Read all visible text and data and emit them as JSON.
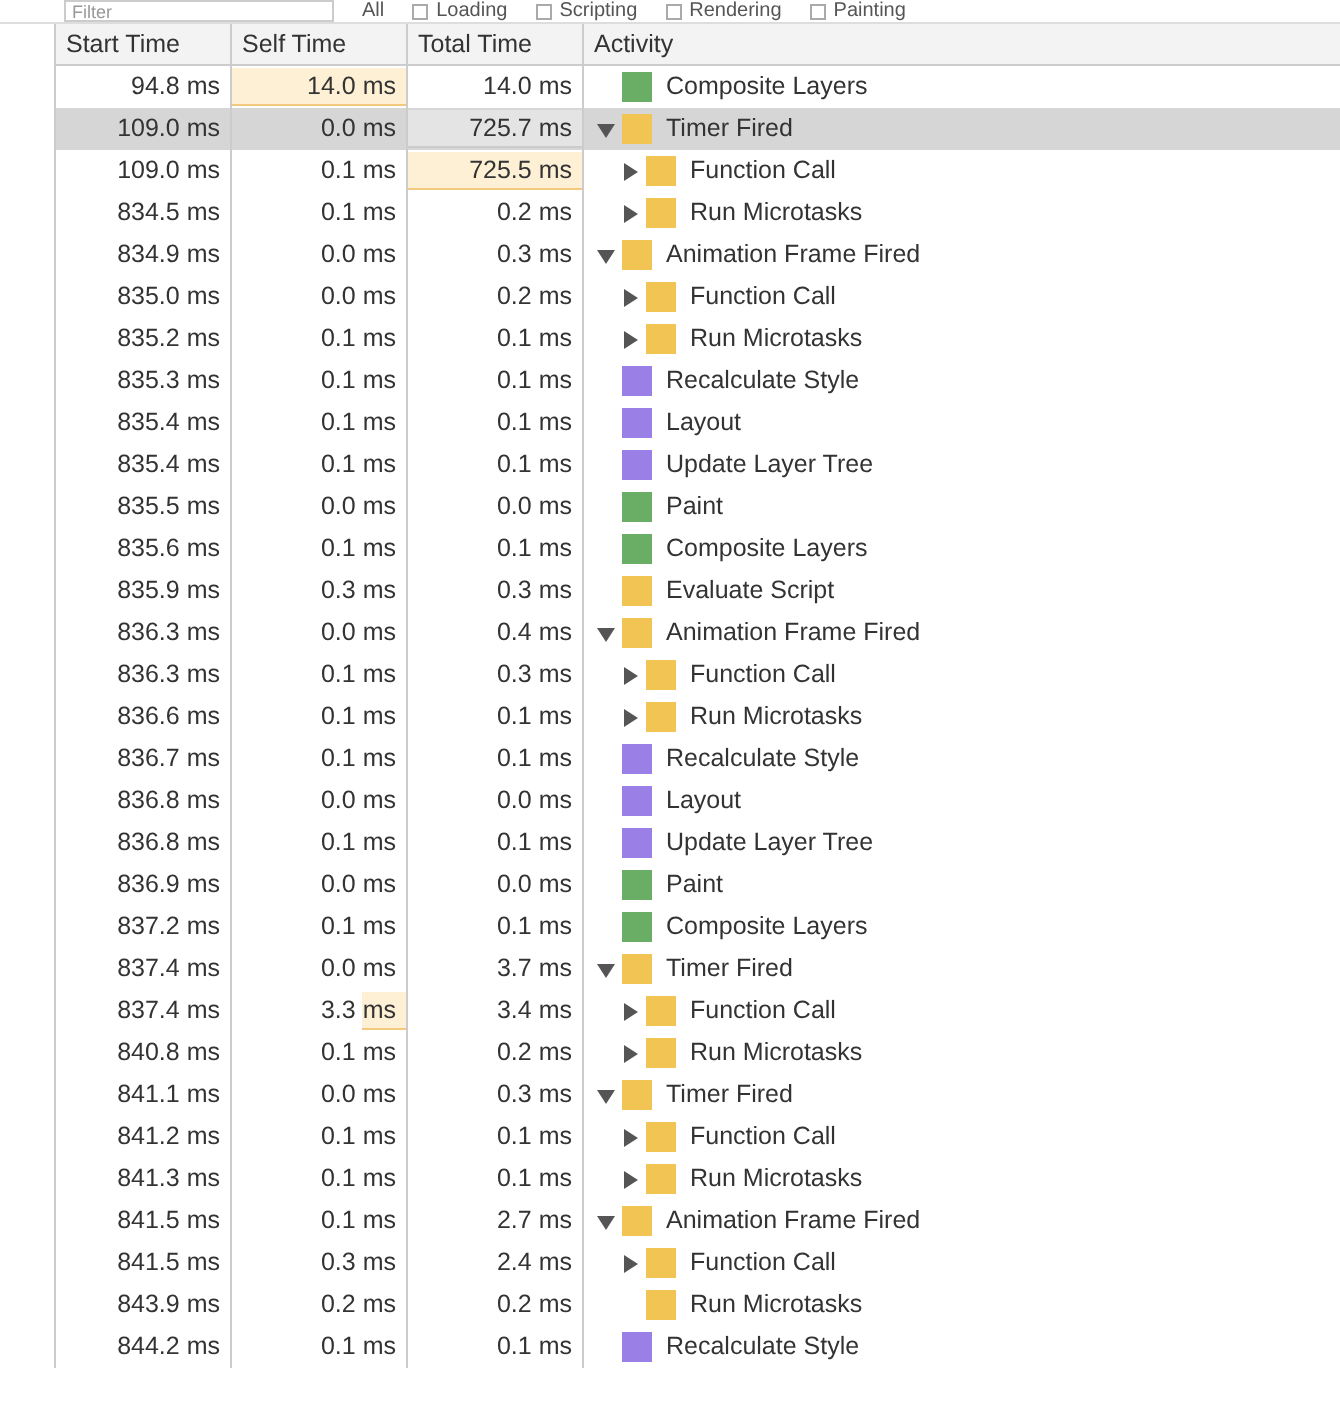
{
  "toolbar": {
    "filter": {
      "placeholder": "Filter"
    },
    "scope": "All",
    "categories": [
      {
        "label": "Loading",
        "checked": false
      },
      {
        "label": "Scripting",
        "checked": false
      },
      {
        "label": "Rendering",
        "checked": false
      },
      {
        "label": "Painting",
        "checked": false
      }
    ]
  },
  "table": {
    "columns": [
      "Start Time",
      "Self Time",
      "Total Time",
      "Activity"
    ],
    "rows": [
      {
        "start": "94.8 ms",
        "self": {
          "text": "14.0 ms",
          "level": 1
        },
        "total": {
          "text": "14.0 ms"
        },
        "activity": "Composite Layers",
        "color": "#6aad64",
        "selected": false
      },
      {
        "start": "109.0 ms",
        "self": {
          "text": "0.0 ms"
        },
        "total": {
          "text": "725.7 ms",
          "level": 1
        },
        "activity": "Timer Fired",
        "color": "#f1c453",
        "selected": true,
        "expanded": true,
        "children": [
          {
            "start": "109.0 ms",
            "self": {
              "text": "0.1 ms"
            },
            "total": {
              "text": "725.5 ms",
              "level": 1
            },
            "activity": "Function Call",
            "color": "#f1c453",
            "selected": false,
            "expanded": false
          },
          {
            "start": "834.5 ms",
            "self": {
              "text": "0.1 ms"
            },
            "total": {
              "text": "0.2 ms"
            },
            "activity": "Run Microtasks",
            "color": "#f1c453",
            "selected": false,
            "expanded": false
          }
        ]
      },
      {
        "start": "834.9 ms",
        "self": {
          "text": "0.0 ms"
        },
        "total": {
          "text": "0.3 ms"
        },
        "activity": "Animation Frame Fired",
        "color": "#f1c453",
        "selected": false,
        "expanded": true,
        "children": [
          {
            "start": "835.0 ms",
            "self": {
              "text": "0.0 ms"
            },
            "total": {
              "text": "0.2 ms"
            },
            "activity": "Function Call",
            "color": "#f1c453",
            "selected": false,
            "expanded": false
          },
          {
            "start": "835.2 ms",
            "self": {
              "text": "0.1 ms"
            },
            "total": {
              "text": "0.1 ms"
            },
            "activity": "Run Microtasks",
            "color": "#f1c453",
            "selected": false,
            "expanded": false
          }
        ]
      },
      {
        "start": "835.3 ms",
        "self": {
          "text": "0.1 ms"
        },
        "total": {
          "text": "0.1 ms"
        },
        "activity": "Recalculate Style",
        "color": "#9a7fe6",
        "selected": false
      },
      {
        "start": "835.4 ms",
        "self": {
          "text": "0.1 ms"
        },
        "total": {
          "text": "0.1 ms"
        },
        "activity": "Layout",
        "color": "#9a7fe6",
        "selected": false
      },
      {
        "start": "835.4 ms",
        "self": {
          "text": "0.1 ms"
        },
        "total": {
          "text": "0.1 ms"
        },
        "activity": "Update Layer Tree",
        "color": "#9a7fe6",
        "selected": false
      },
      {
        "start": "835.5 ms",
        "self": {
          "text": "0.0 ms"
        },
        "total": {
          "text": "0.0 ms"
        },
        "activity": "Paint",
        "color": "#6aad64",
        "selected": false
      },
      {
        "start": "835.6 ms",
        "self": {
          "text": "0.1 ms"
        },
        "total": {
          "text": "0.1 ms"
        },
        "activity": "Composite Layers",
        "color": "#6aad64",
        "selected": false
      },
      {
        "start": "835.9 ms",
        "self": {
          "text": "0.3 ms"
        },
        "total": {
          "text": "0.3 ms"
        },
        "activity": "Evaluate Script",
        "color": "#f1c453",
        "selected": false
      },
      {
        "start": "836.3 ms",
        "self": {
          "text": "0.0 ms"
        },
        "total": {
          "text": "0.4 ms"
        },
        "activity": "Animation Frame Fired",
        "color": "#f1c453",
        "selected": false,
        "expanded": true,
        "children": [
          {
            "start": "836.3 ms",
            "self": {
              "text": "0.1 ms"
            },
            "total": {
              "text": "0.3 ms"
            },
            "activity": "Function Call",
            "color": "#f1c453",
            "selected": false,
            "expanded": false
          },
          {
            "start": "836.6 ms",
            "self": {
              "text": "0.1 ms"
            },
            "total": {
              "text": "0.1 ms"
            },
            "activity": "Run Microtasks",
            "color": "#f1c453",
            "selected": false,
            "expanded": false
          }
        ]
      },
      {
        "start": "836.7 ms",
        "self": {
          "text": "0.1 ms"
        },
        "total": {
          "text": "0.1 ms"
        },
        "activity": "Recalculate Style",
        "color": "#9a7fe6",
        "selected": false
      },
      {
        "start": "836.8 ms",
        "self": {
          "text": "0.0 ms"
        },
        "total": {
          "text": "0.0 ms"
        },
        "activity": "Layout",
        "color": "#9a7fe6",
        "selected": false
      },
      {
        "start": "836.8 ms",
        "self": {
          "text": "0.1 ms"
        },
        "total": {
          "text": "0.1 ms"
        },
        "activity": "Update Layer Tree",
        "color": "#9a7fe6",
        "selected": false
      },
      {
        "start": "836.9 ms",
        "self": {
          "text": "0.0 ms"
        },
        "total": {
          "text": "0.0 ms"
        },
        "activity": "Paint",
        "color": "#6aad64",
        "selected": false
      },
      {
        "start": "837.2 ms",
        "self": {
          "text": "0.1 ms"
        },
        "total": {
          "text": "0.1 ms"
        },
        "activity": "Composite Layers",
        "color": "#6aad64",
        "selected": false
      },
      {
        "start": "837.4 ms",
        "self": {
          "text": "0.0 ms"
        },
        "total": {
          "text": "3.7 ms"
        },
        "activity": "Timer Fired",
        "color": "#f1c453",
        "selected": false,
        "expanded": true,
        "children": [
          {
            "start": "837.4 ms",
            "self": {
              "text": "3.3 ms",
              "level": 0.25
            },
            "total": {
              "text": "3.4 ms"
            },
            "activity": "Function Call",
            "color": "#f1c453",
            "selected": false,
            "expanded": false
          },
          {
            "start": "840.8 ms",
            "self": {
              "text": "0.1 ms"
            },
            "total": {
              "text": "0.2 ms"
            },
            "activity": "Run Microtasks",
            "color": "#f1c453",
            "selected": false,
            "expanded": false
          }
        ]
      },
      {
        "start": "841.1 ms",
        "self": {
          "text": "0.0 ms"
        },
        "total": {
          "text": "0.3 ms"
        },
        "activity": "Timer Fired",
        "color": "#f1c453",
        "selected": false,
        "expanded": true,
        "children": [
          {
            "start": "841.2 ms",
            "self": {
              "text": "0.1 ms"
            },
            "total": {
              "text": "0.1 ms"
            },
            "activity": "Function Call",
            "color": "#f1c453",
            "selected": false,
            "expanded": false
          },
          {
            "start": "841.3 ms",
            "self": {
              "text": "0.1 ms"
            },
            "total": {
              "text": "0.1 ms"
            },
            "activity": "Run Microtasks",
            "color": "#f1c453",
            "selected": false,
            "expanded": false
          }
        ]
      },
      {
        "start": "841.5 ms",
        "self": {
          "text": "0.1 ms"
        },
        "total": {
          "text": "2.7 ms"
        },
        "activity": "Animation Frame Fired",
        "color": "#f1c453",
        "selected": false,
        "expanded": true,
        "children": [
          {
            "start": "841.5 ms",
            "self": {
              "text": "0.3 ms"
            },
            "total": {
              "text": "2.4 ms"
            },
            "activity": "Function Call",
            "color": "#f1c453",
            "selected": false,
            "expanded": false
          },
          {
            "start": "843.9 ms",
            "self": {
              "text": "0.2 ms"
            },
            "total": {
              "text": "0.2 ms"
            },
            "activity": "Run Microtasks",
            "color": "#f1c453",
            "selected": false
          }
        ]
      },
      {
        "start": "844.2 ms",
        "self": {
          "text": "0.1 ms"
        },
        "total": {
          "text": "0.1 ms"
        },
        "activity": "Recalculate Style",
        "color": "#9a7fe6",
        "selected": false
      }
    ]
  }
}
